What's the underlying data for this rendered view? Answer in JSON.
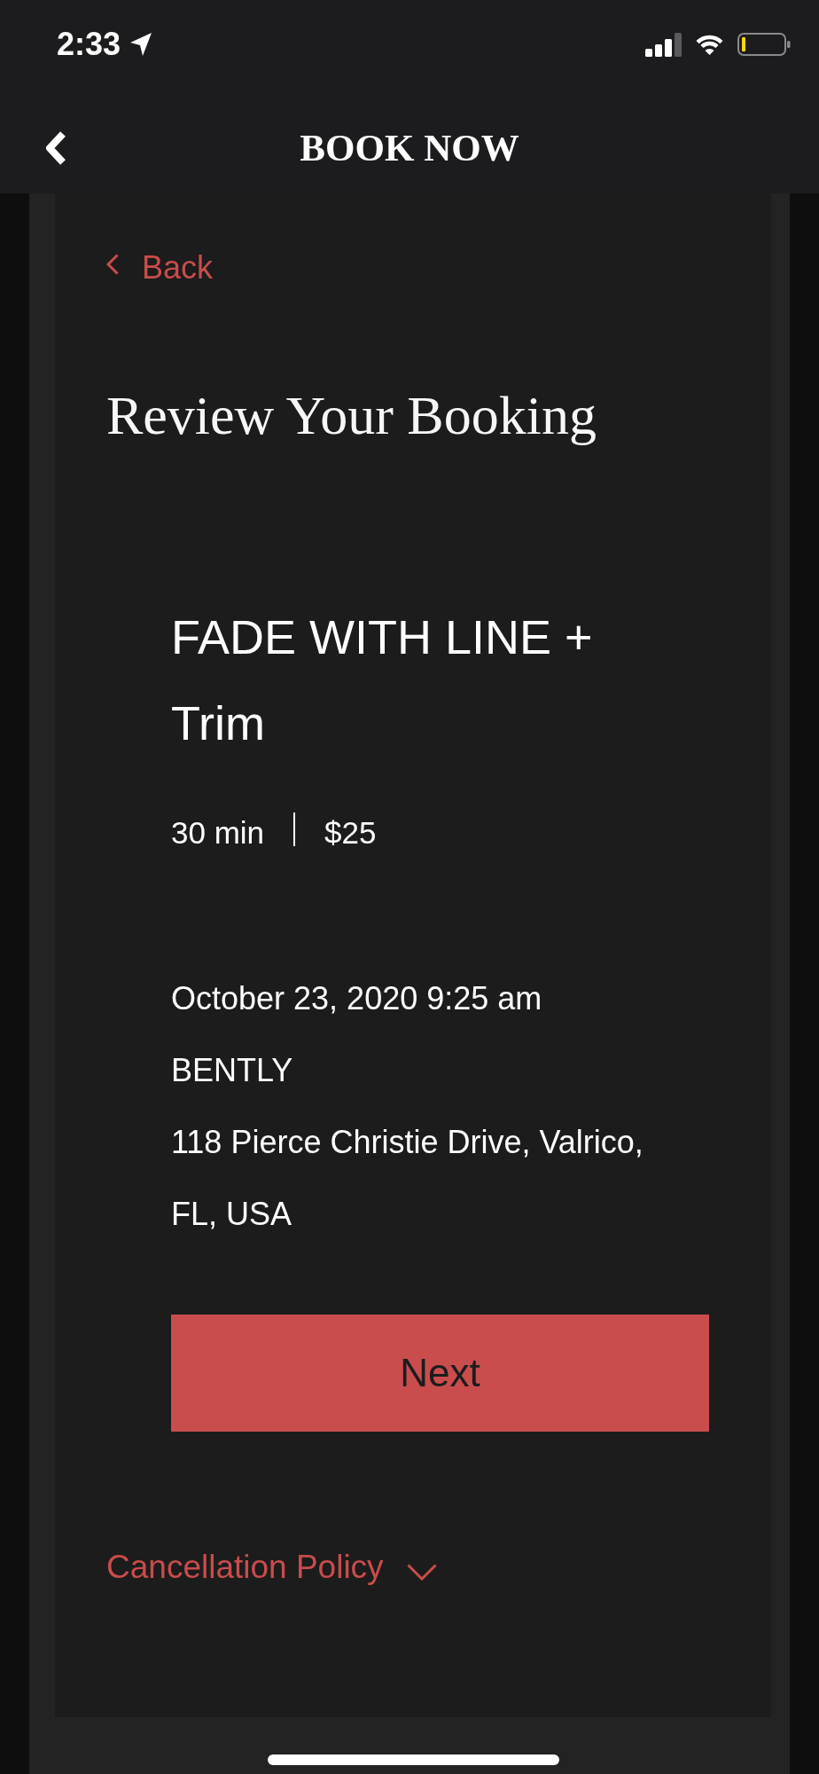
{
  "status_bar": {
    "time": "2:33"
  },
  "header": {
    "title": "BOOK NOW"
  },
  "back_link": {
    "label": "Back"
  },
  "page_title": "Review Your Booking",
  "service": {
    "name": "FADE WITH LINE + Trim",
    "duration": "30 min",
    "price": "$25"
  },
  "booking_details": {
    "date_time": "October 23, 2020 9:25 am",
    "provider": "BENTLY",
    "address": "118 Pierce Christie Drive, Valrico, FL, USA"
  },
  "next_button": {
    "label": "Next"
  },
  "cancellation_policy": {
    "label": "Cancellation Policy",
    "expanded": false
  }
}
